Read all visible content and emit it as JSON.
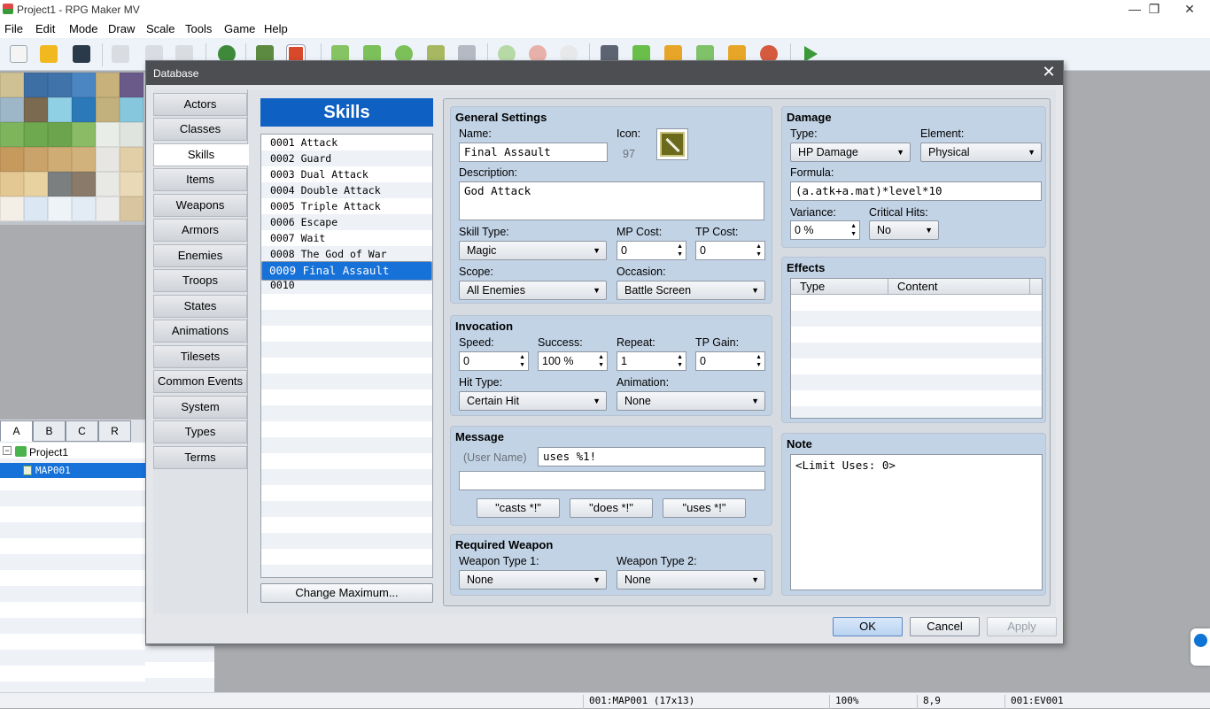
{
  "window": {
    "title": "Project1 - RPG Maker MV",
    "minimize": "—",
    "restore": "❐",
    "close": "✕"
  },
  "menu": [
    "File",
    "Edit",
    "Mode",
    "Draw",
    "Scale",
    "Tools",
    "Game",
    "Help"
  ],
  "tileset_tabs": [
    "A",
    "B",
    "C",
    "R"
  ],
  "map_tree": {
    "root": "Project1",
    "child": "MAP001"
  },
  "statusbar": {
    "map": "001:MAP001 (17x13)",
    "zoom": "100%",
    "coords": "8,9",
    "event": "001:EV001"
  },
  "dialog": {
    "title": "Database",
    "close": "✕",
    "categories": [
      "Actors",
      "Classes",
      "Skills",
      "Items",
      "Weapons",
      "Armors",
      "Enemies",
      "Troops",
      "States",
      "Animations",
      "Tilesets",
      "Common Events",
      "System",
      "Types",
      "Terms"
    ],
    "list_title": "Skills",
    "skills": [
      "0001 Attack",
      "0002 Guard",
      "0003 Dual Attack",
      "0004 Double Attack",
      "0005 Triple Attack",
      "0006 Escape",
      "0007 Wait",
      "0008 The God of War",
      "0009 Final Assault",
      "0010"
    ],
    "change_max": "Change Maximum...",
    "general": {
      "title": "General Settings",
      "name_label": "Name:",
      "name": "Final Assault",
      "icon_label": "Icon:",
      "icon_index": "97",
      "desc_label": "Description:",
      "desc": "God Attack",
      "skill_type_label": "Skill Type:",
      "skill_type": "Magic",
      "mp_label": "MP Cost:",
      "mp": "0",
      "tp_label": "TP Cost:",
      "tp": "0",
      "scope_label": "Scope:",
      "scope": "All Enemies",
      "occasion_label": "Occasion:",
      "occasion": "Battle Screen"
    },
    "invocation": {
      "title": "Invocation",
      "speed_label": "Speed:",
      "speed": "0",
      "success_label": "Success:",
      "success": "100 %",
      "repeat_label": "Repeat:",
      "repeat": "1",
      "tpgain_label": "TP Gain:",
      "tpgain": "0",
      "hittype_label": "Hit Type:",
      "hittype": "Certain Hit",
      "animation_label": "Animation:",
      "animation": "None"
    },
    "message": {
      "title": "Message",
      "username": "(User Name)",
      "line1": "uses %1!",
      "line2": "",
      "btn1": "\"casts *!\"",
      "btn2": "\"does *!\"",
      "btn3": "\"uses *!\""
    },
    "weapon": {
      "title": "Required Weapon",
      "wt1_label": "Weapon Type 1:",
      "wt1": "None",
      "wt2_label": "Weapon Type 2:",
      "wt2": "None"
    },
    "damage": {
      "title": "Damage",
      "type_label": "Type:",
      "type": "HP Damage",
      "element_label": "Element:",
      "element": "Physical",
      "formula_label": "Formula:",
      "formula": "(a.atk+a.mat)*level*10",
      "variance_label": "Variance:",
      "variance": "0 %",
      "crit_label": "Critical Hits:",
      "crit": "No"
    },
    "effects": {
      "title": "Effects",
      "col_type": "Type",
      "col_content": "Content"
    },
    "note": {
      "title": "Note",
      "text": "<Limit Uses: 0>"
    },
    "buttons": {
      "ok": "OK",
      "cancel": "Cancel",
      "apply": "Apply"
    }
  },
  "colors": {
    "accent": "#0e61c3",
    "selection": "#1671d8",
    "group": "#c2d3e6",
    "dialog_title": "#4c4e52"
  }
}
